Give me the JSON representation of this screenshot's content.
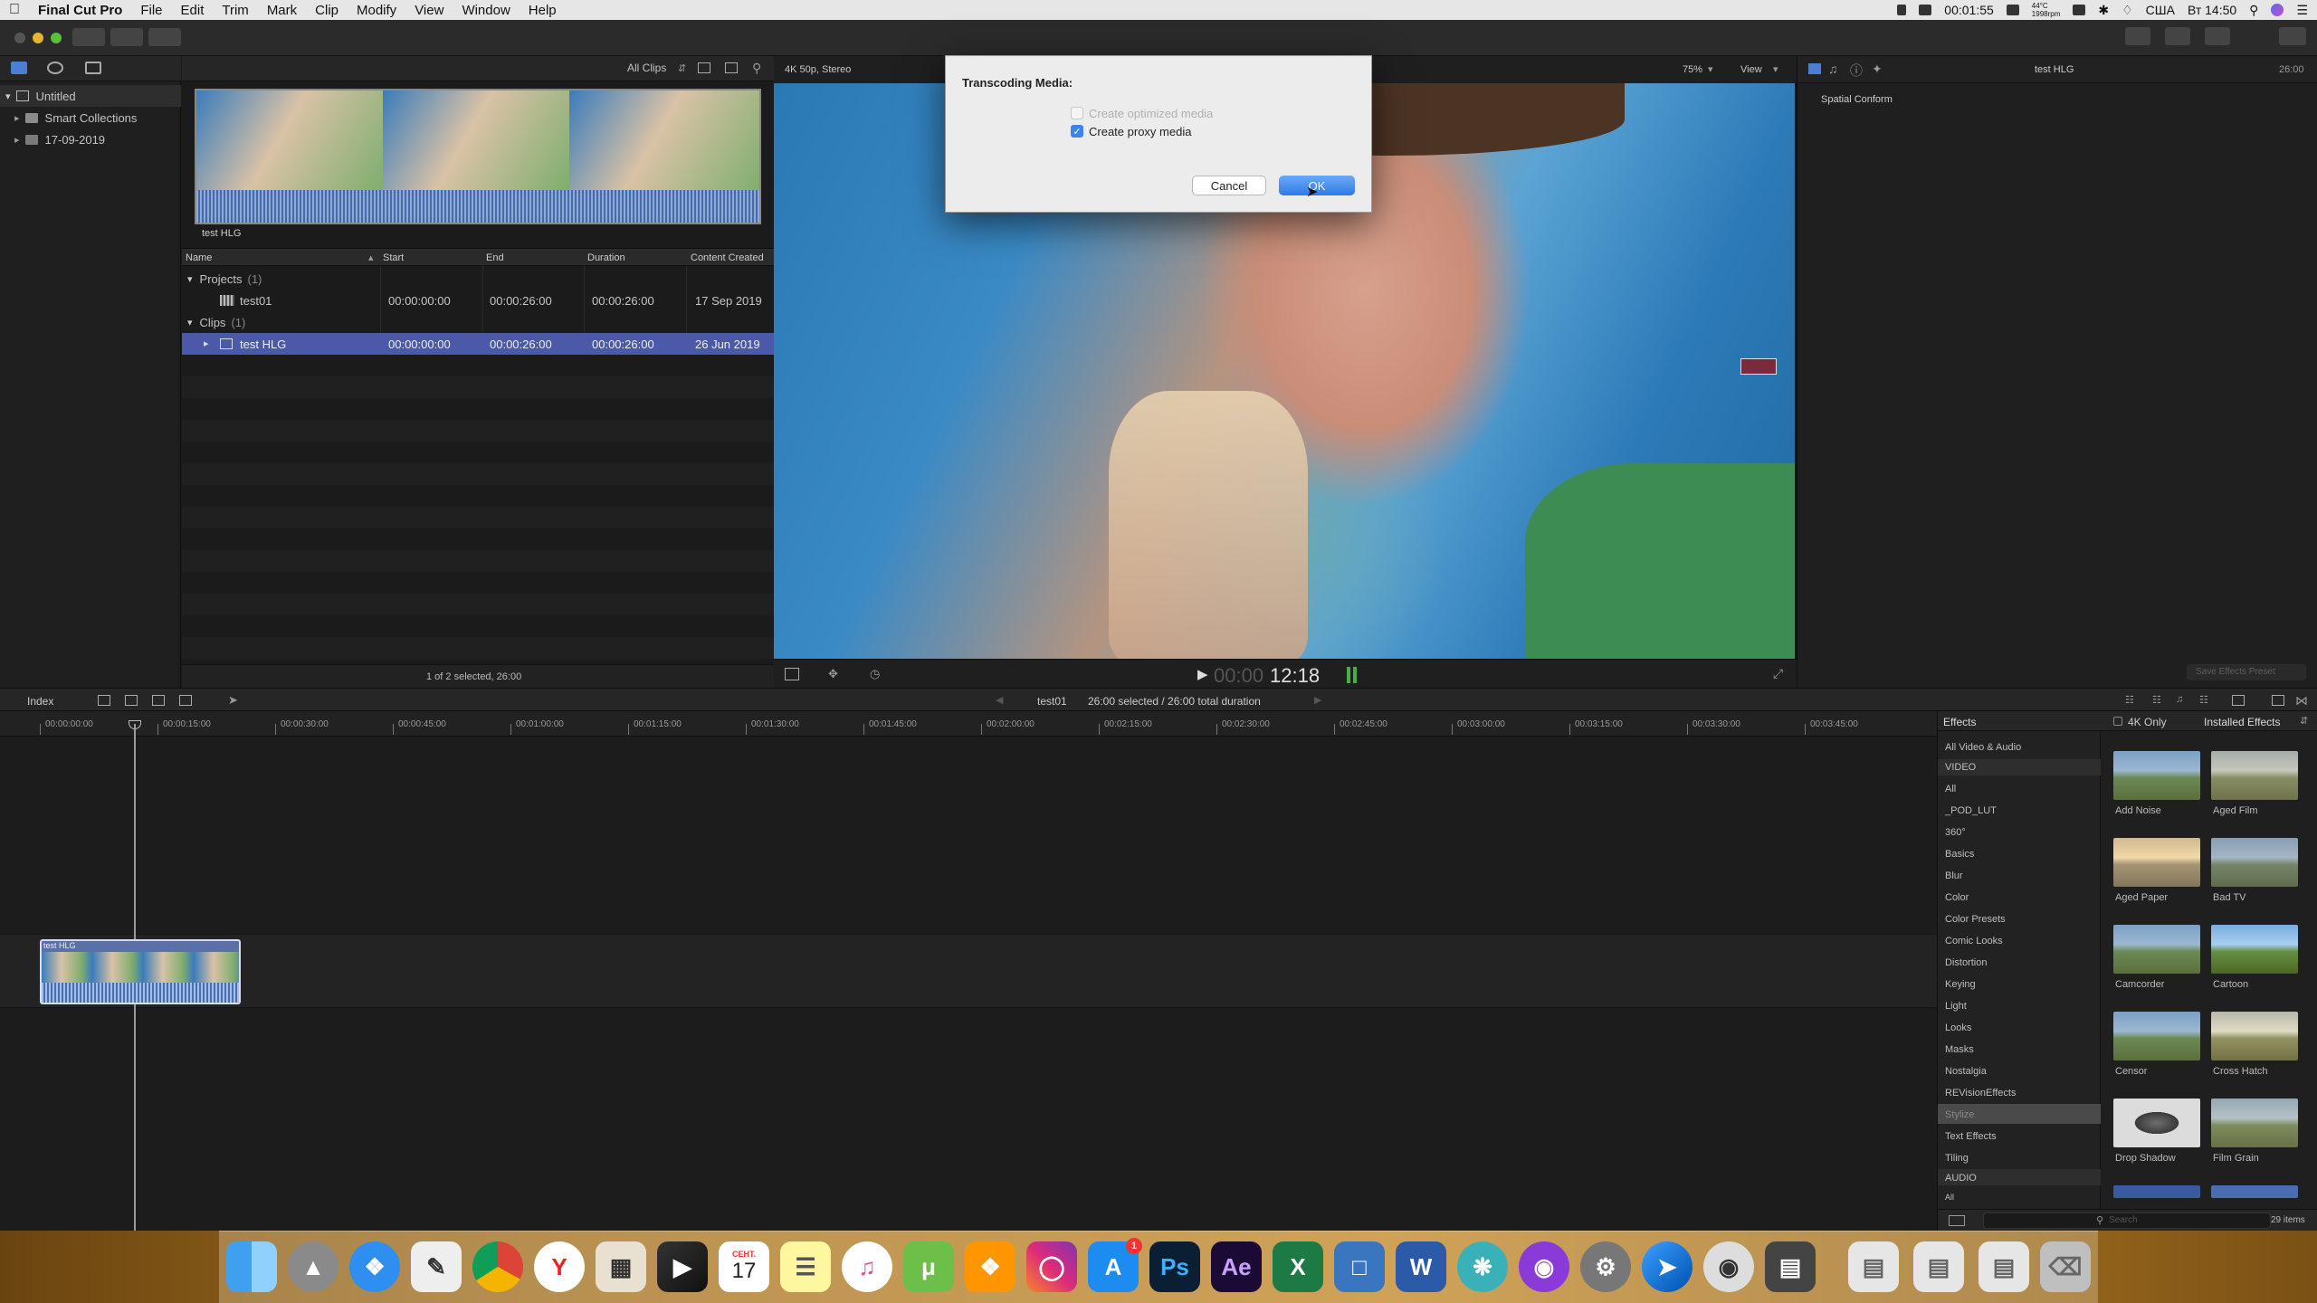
{
  "menubar": {
    "app_name": "Final Cut Pro",
    "items": [
      "File",
      "Edit",
      "Trim",
      "Mark",
      "Clip",
      "Modify",
      "View",
      "Window",
      "Help"
    ],
    "status": {
      "timer": "00:01:55",
      "temp": "44°C",
      "rpm": "1998rpm",
      "input_source": "США",
      "clock": "Вт 14:50"
    }
  },
  "library": {
    "name": "Untitled",
    "items": [
      "Smart Collections",
      "17-09-2019"
    ]
  },
  "browser": {
    "filter_label": "All Clips",
    "filmstrip_caption": "test HLG",
    "columns": [
      "Name",
      "Start",
      "End",
      "Duration",
      "Content Created"
    ],
    "groups": [
      {
        "label": "Projects",
        "count": "(1)"
      },
      {
        "label": "Clips",
        "count": "(1)"
      }
    ],
    "rows": [
      {
        "name": "test01",
        "start": "00:00:00:00",
        "end": "00:00:26:00",
        "duration": "00:00:26:00",
        "created": "17 Sep 2019"
      },
      {
        "name": "test HLG",
        "start": "00:00:00:00",
        "end": "00:00:26:00",
        "duration": "00:00:26:00",
        "created": "26 Jun 2019"
      }
    ],
    "footer": "1 of 2 selected, 26:00"
  },
  "viewer": {
    "format": "4K 50p, Stereo",
    "zoom": "75%",
    "view_label": "View",
    "timecode_dim": "00:00",
    "timecode_bright": "12:18"
  },
  "inspector": {
    "title": "test HLG",
    "duration": "26:00",
    "section": "Spatial Conform",
    "save_button": "Save Effects Preset"
  },
  "timeline": {
    "index_label": "Index",
    "project": "test01",
    "selection": "26:00 selected / 26:00 total duration",
    "ruler": [
      "00:00:00:00",
      "00:00:15:00",
      "00:00:30:00",
      "00:00:45:00",
      "00:01:00:00",
      "00:01:15:00",
      "00:01:30:00",
      "00:01:45:00",
      "00:02:00:00",
      "00:02:15:00",
      "00:02:30:00",
      "00:02:45:00",
      "00:03:00:00",
      "00:03:15:00",
      "00:03:30:00",
      "00:03:45:00"
    ],
    "clip_label": "test HLG"
  },
  "effects": {
    "title": "Effects",
    "filter_4k": "4K Only",
    "installed": "Installed Effects",
    "categories": [
      "All Video & Audio",
      "VIDEO",
      "All",
      "_POD_LUT",
      "360°",
      "Basics",
      "Blur",
      "Color",
      "Color Presets",
      "Comic Looks",
      "Distortion",
      "Keying",
      "Light",
      "Looks",
      "Masks",
      "Nostalgia",
      "REVisionEffects",
      "Stylize",
      "Text Effects",
      "Tiling",
      "AUDIO",
      "All"
    ],
    "thumbnails": [
      "Add Noise",
      "Aged Film",
      "Aged Paper",
      "Bad TV",
      "Camcorder",
      "Cartoon",
      "Censor",
      "Cross Hatch",
      "Drop Shadow",
      "Film Grain"
    ],
    "search_placeholder": "Search",
    "count": "29 items"
  },
  "dialog": {
    "title": "Transcoding Media:",
    "option_optimized": "Create optimized media",
    "option_proxy": "Create proxy media",
    "cancel": "Cancel",
    "ok": "OK"
  },
  "dock": {
    "calendar_month": "СЕНТ.",
    "calendar_day": "17",
    "appstore_badge": "1"
  }
}
